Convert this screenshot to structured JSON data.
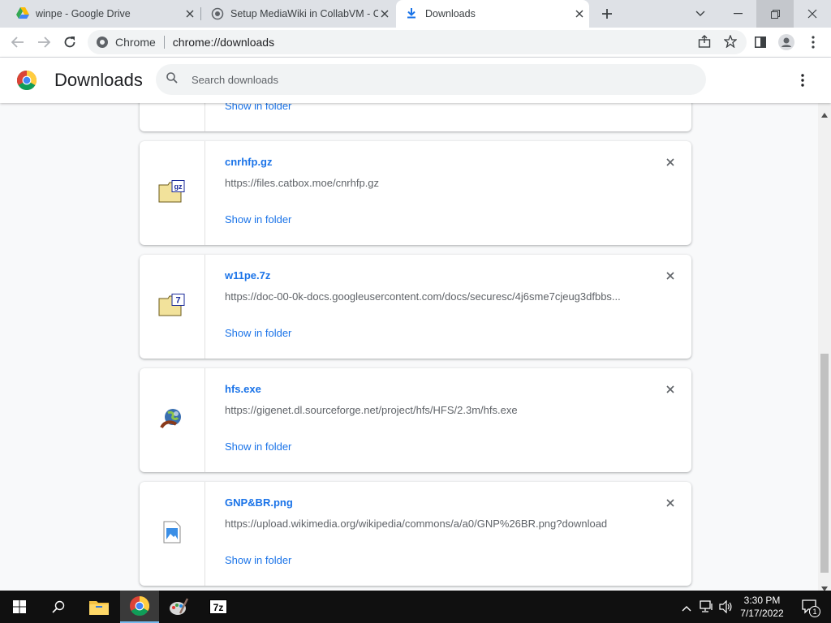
{
  "tabs": [
    {
      "title": "winpe - Google Drive",
      "icon": "google-drive-icon"
    },
    {
      "title": "Setup MediaWiki in CollabVM - C",
      "icon": "globe-icon"
    },
    {
      "title": "Downloads",
      "icon": "download-icon",
      "active": true
    }
  ],
  "omnibox": {
    "scheme_label": "Chrome",
    "url": "chrome://downloads"
  },
  "page": {
    "title": "Downloads",
    "search_placeholder": "Search downloads"
  },
  "downloads": [
    {
      "show_label": "Show in folder"
    },
    {
      "name": "cnrhfp.gz",
      "url": "https://files.catbox.moe/cnrhfp.gz",
      "show_label": "Show in folder",
      "icon_badge": "gz"
    },
    {
      "name": "w11pe.7z",
      "url": "https://doc-00-0k-docs.googleusercontent.com/docs/securesc/4j6sme7cjeug3dfbbs...",
      "show_label": "Show in folder",
      "icon_badge": "7"
    },
    {
      "name": "hfs.exe",
      "url": "https://gigenet.dl.sourceforge.net/project/hfs/HFS/2.3m/hfs.exe",
      "show_label": "Show in folder"
    },
    {
      "name": "GNP&BR.png",
      "url": "https://upload.wikimedia.org/wikipedia/commons/a/a0/GNP%26BR.png?download",
      "show_label": "Show in folder"
    }
  ],
  "taskbar": {
    "time": "3:30 PM",
    "date": "7/17/2022",
    "notification_count": "1",
    "sevenzip_label": "7z"
  },
  "colors": {
    "accent": "#1a73e8",
    "tabstrip": "#dee1e6",
    "taskbar": "#101010"
  }
}
